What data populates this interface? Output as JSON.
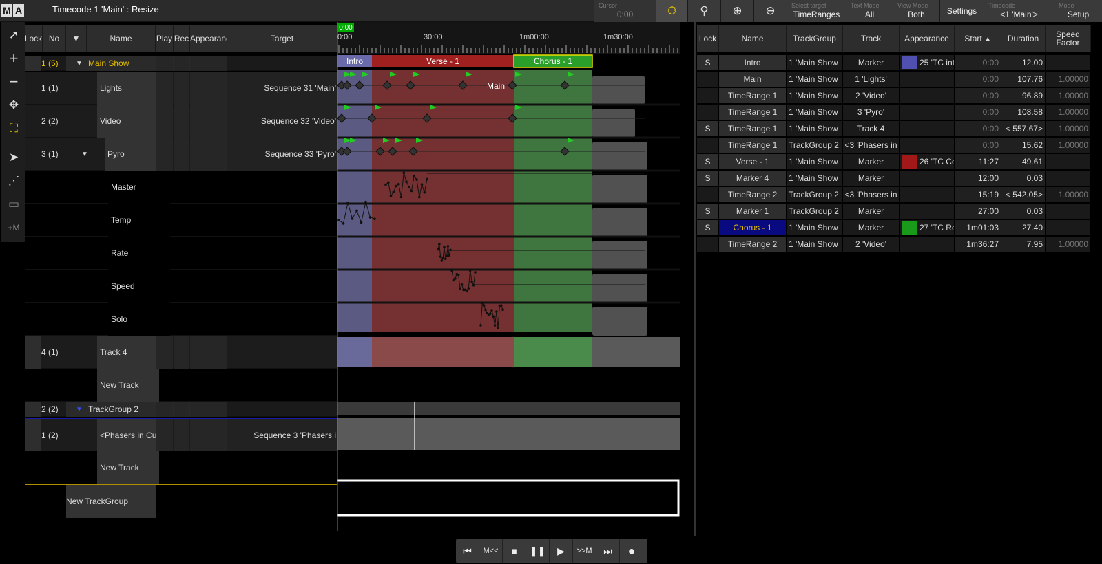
{
  "window": {
    "title": "Timecode 1 'Main' : Resize",
    "logo": [
      "M",
      "A"
    ]
  },
  "toolbar": {
    "cursor_label": "Cursor",
    "cursor_value": "0:00",
    "select_target_label": "Select target",
    "select_target_value": "TimeRanges",
    "text_mode_label": "Text Mode",
    "text_mode_value": "All",
    "view_mode_label": "View Mode",
    "view_mode_value": "Both",
    "settings_label": "Settings",
    "timecode_label": "Timecode",
    "timecode_value": "<1 'Main'>",
    "mode_label": "Mode",
    "mode_value": "Setup",
    "icons": [
      "stopwatch-icon",
      "search-icon",
      "zoom-in-icon",
      "zoom-out-icon"
    ]
  },
  "left_tools": [
    "pointer-icon",
    "plus-icon",
    "minus-icon",
    "move-icon",
    "fit-icon",
    "play-cursor-icon",
    "path-icon",
    "ruler-icon",
    "+M"
  ],
  "tracks_header": {
    "lock": "Lock",
    "no": "No",
    "name": "Name",
    "play": "Play",
    "rec": "Rec",
    "appearance": "Appearance",
    "target": "Target"
  },
  "tracks": [
    {
      "no": "1 (5)",
      "name": "Main Show",
      "target": ""
    },
    {
      "no": "1 (1)",
      "name": "Lights",
      "target": "Sequence 31 'Main'"
    },
    {
      "no": "2 (2)",
      "name": "Video",
      "target": "Sequence 32 'Video'"
    },
    {
      "no": "3 (1)",
      "name": "Pyro",
      "target": "Sequence 33 'Pyro'"
    },
    {
      "no": "",
      "name": "Master",
      "target": ""
    },
    {
      "no": "",
      "name": "Temp",
      "target": ""
    },
    {
      "no": "",
      "name": "Rate",
      "target": ""
    },
    {
      "no": "",
      "name": "Speed",
      "target": ""
    },
    {
      "no": "",
      "name": "Solo",
      "target": ""
    },
    {
      "no": "4 (1)",
      "name": "Track 4",
      "target": ""
    },
    {
      "no": "",
      "name": "New Track",
      "target": ""
    },
    {
      "no": "2 (2)",
      "name": "TrackGroup 2",
      "target": ""
    },
    {
      "no": "1 (2)",
      "name": "<Phasers in Cu",
      "target": "Sequence 3 'Phasers i"
    },
    {
      "no": "",
      "name": "New Track",
      "target": ""
    },
    {
      "no": "",
      "name": "New TrackGroup",
      "target": ""
    }
  ],
  "timeline": {
    "cursor_time": "0:00",
    "ruler_labels": [
      "0:00",
      "30:00",
      "1m00:00",
      "1m30:00"
    ],
    "ranges": [
      {
        "label": "Intro",
        "color": "#6a6aaa"
      },
      {
        "label": "Verse - 1",
        "color": "#a02020"
      },
      {
        "label": "Chorus - 1",
        "color": "#2aa02a"
      }
    ],
    "inline_label": "Main"
  },
  "right_header": {
    "lock": "Lock",
    "name": "Name",
    "trackgroup": "TrackGroup",
    "track": "Track",
    "appearance": "Appearance",
    "start": "Start",
    "duration": "Duration",
    "speed": "Speed Factor"
  },
  "right_rows": [
    {
      "lock": "S",
      "name": "Intro",
      "tg": "1 'Main Show",
      "track": "Marker",
      "app": "25 'TC int",
      "app_color": "#5050b0",
      "start": "0:00",
      "dur": "12.00",
      "speed": ""
    },
    {
      "lock": "",
      "name": "Main",
      "tg": "1 'Main Show",
      "track": "1 'Lights'",
      "app": "",
      "app_color": "",
      "start": "0:00",
      "dur": "107.76",
      "speed": "1.00000"
    },
    {
      "lock": "",
      "name": "TimeRange 1",
      "tg": "1 'Main Show",
      "track": "2 'Video'",
      "app": "",
      "app_color": "",
      "start": "0:00",
      "dur": "96.89",
      "speed": "1.00000"
    },
    {
      "lock": "",
      "name": "TimeRange 1",
      "tg": "1 'Main Show",
      "track": "3 'Pyro'",
      "app": "",
      "app_color": "",
      "start": "0:00",
      "dur": "108.58",
      "speed": "1.00000"
    },
    {
      "lock": "S",
      "name": "TimeRange 1",
      "tg": "1 'Main Show",
      "track": "Track 4",
      "app": "",
      "app_color": "",
      "start": "0:00",
      "dur": "< 557.67>",
      "speed": "1.00000"
    },
    {
      "lock": "",
      "name": "TimeRange 1",
      "tg": "TrackGroup 2",
      "track": "<3 'Phasers in",
      "app": "",
      "app_color": "",
      "start": "0:00",
      "dur": "15.62",
      "speed": "1.00000"
    },
    {
      "lock": "S",
      "name": "Verse - 1",
      "tg": "1 'Main Show",
      "track": "Marker",
      "app": "26 'TC Co",
      "app_color": "#a01818",
      "start": "11:27",
      "dur": "49.61",
      "speed": ""
    },
    {
      "lock": "S",
      "name": "Marker 4",
      "tg": "1 'Main Show",
      "track": "Marker",
      "app": "",
      "app_color": "",
      "start": "12:00",
      "dur": "0.03",
      "speed": ""
    },
    {
      "lock": "",
      "name": "TimeRange 2",
      "tg": "TrackGroup 2",
      "track": "<3 'Phasers in",
      "app": "",
      "app_color": "",
      "start": "15:19",
      "dur": "< 542.05>",
      "speed": "1.00000"
    },
    {
      "lock": "S",
      "name": "Marker 1",
      "tg": "TrackGroup 2",
      "track": "Marker",
      "app": "",
      "app_color": "",
      "start": "27:00",
      "dur": "0.03",
      "speed": ""
    },
    {
      "lock": "S",
      "name": "Chorus - 1",
      "tg": "1 'Main Show",
      "track": "Marker",
      "app": "27 'TC Re",
      "app_color": "#1a9a1a",
      "start": "1m01:03",
      "dur": "27.40",
      "speed": ""
    },
    {
      "lock": "",
      "name": "TimeRange 2",
      "tg": "1 'Main Show",
      "track": "2 'Video'",
      "app": "",
      "app_color": "",
      "start": "1m36:27",
      "dur": "7.95",
      "speed": "1.00000"
    }
  ],
  "transport": [
    "skip-start-icon",
    "M<<",
    "stop-icon",
    "pause-icon",
    "play-icon",
    ">>M",
    "skip-end-icon",
    "record-icon"
  ]
}
